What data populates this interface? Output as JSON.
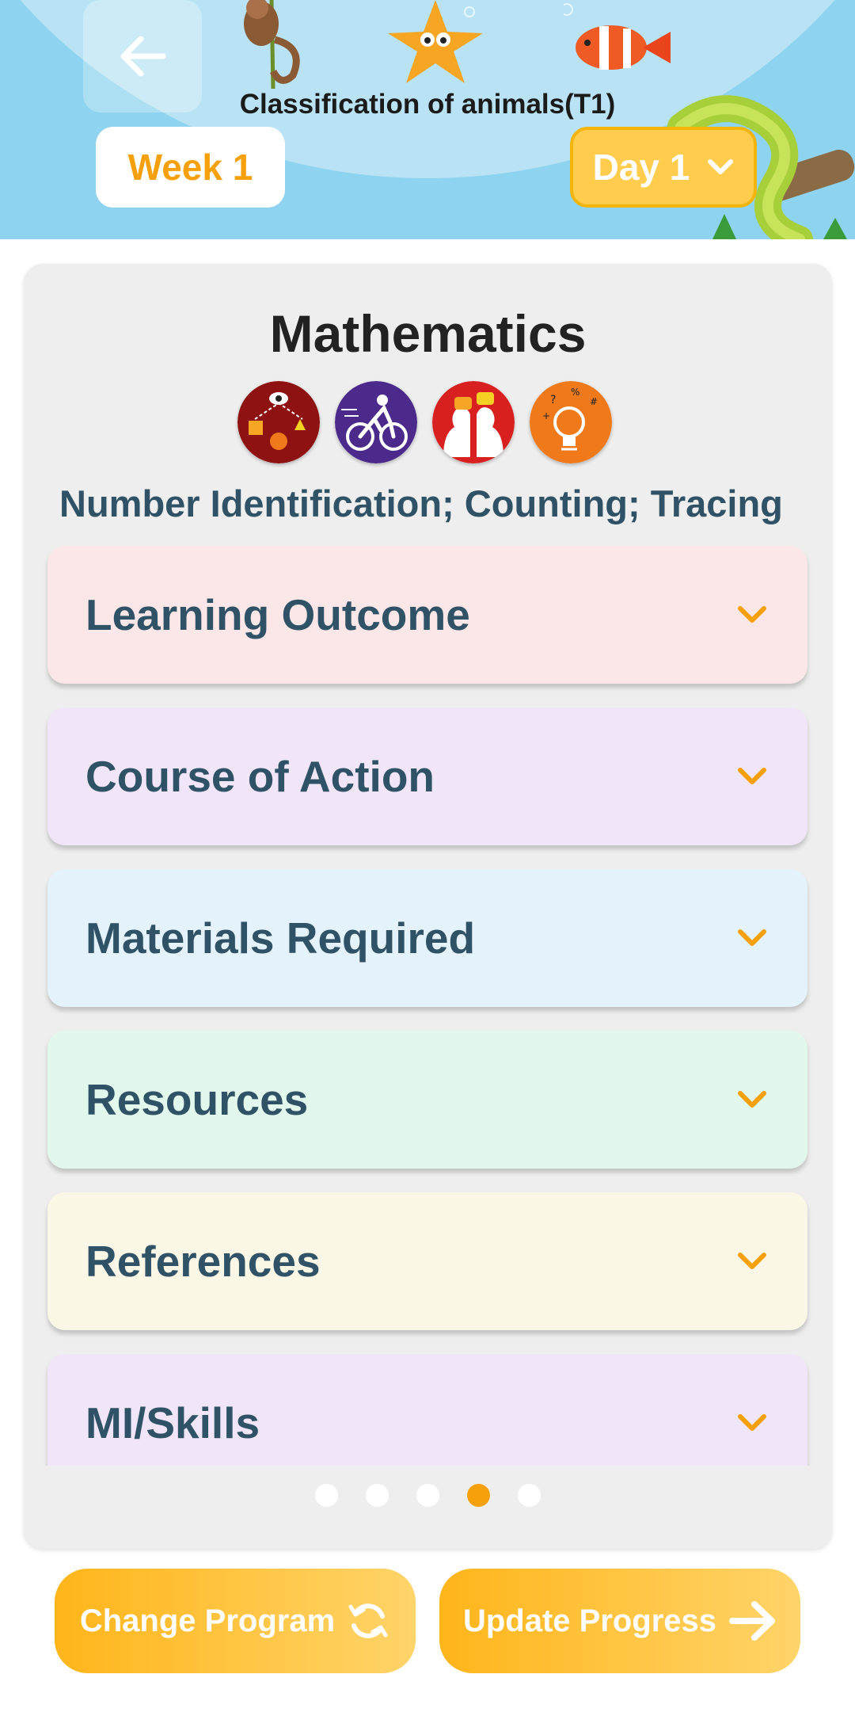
{
  "header": {
    "title": "Classification of animals(T1)",
    "week_label": "Week 1",
    "day_label": "Day 1",
    "back_icon": "arrow-left-icon"
  },
  "lesson": {
    "subject": "Mathematics",
    "topic": "Number Identification; Counting; Tracing",
    "mi_icons": [
      "visual-spatial-icon",
      "bodily-kinesthetic-icon",
      "interpersonal-icon",
      "logical-mathematical-icon"
    ]
  },
  "sections": [
    {
      "label": "Learning Outcome",
      "color": "#fbe6e8"
    },
    {
      "label": "Course of Action",
      "color": "#f1e5fa"
    },
    {
      "label": "Materials Required",
      "color": "#e4f2fb"
    },
    {
      "label": "Resources",
      "color": "#e3f8ec"
    },
    {
      "label": "References",
      "color": "#faf7e6"
    },
    {
      "label": "MI/Skills",
      "color": "#f1e5fa"
    }
  ],
  "pagination": {
    "count": 5,
    "active_page": 4
  },
  "actions": {
    "change_program_label": "Change Program",
    "update_progress_label": "Update Progress"
  },
  "colors": {
    "accent": "#f6a10c",
    "text_dark_teal": "#2f5266",
    "header_sky": "#8ed3ef"
  }
}
